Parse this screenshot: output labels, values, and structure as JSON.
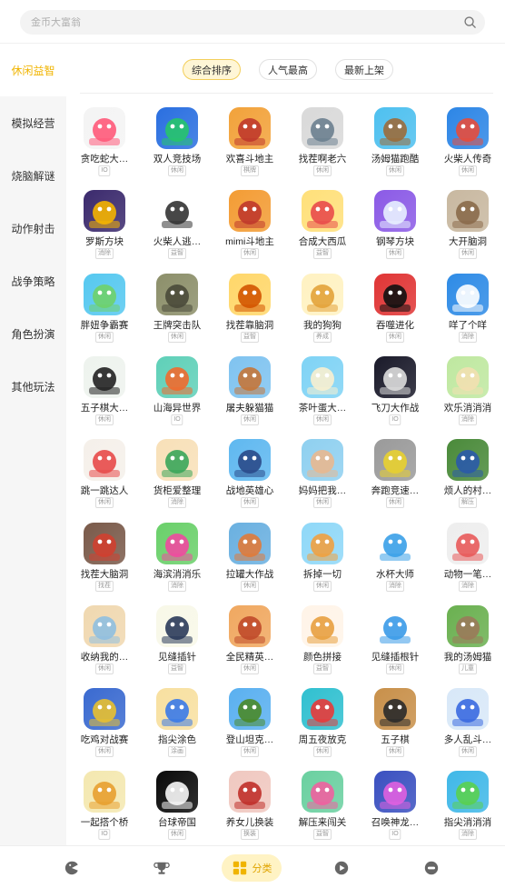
{
  "search": {
    "placeholder": "金币大富翁"
  },
  "sidebar": {
    "items": [
      {
        "label": "休闲益智",
        "active": true
      },
      {
        "label": "模拟经营"
      },
      {
        "label": "烧脑解谜"
      },
      {
        "label": "动作射击"
      },
      {
        "label": "战争策略"
      },
      {
        "label": "角色扮演"
      },
      {
        "label": "其他玩法"
      }
    ]
  },
  "sort": {
    "options": [
      {
        "label": "综合排序",
        "active": true
      },
      {
        "label": "人气最高"
      },
      {
        "label": "最新上架"
      }
    ]
  },
  "colors": {
    "accent": "#f0b400",
    "accent_bg": "#fff3c4",
    "sidebar_bg": "#f6f6f6"
  },
  "games": [
    {
      "name": "贪吃蛇大…",
      "tag": "IO",
      "c1": "#f4f4f4",
      "c2": "#ff5a7a"
    },
    {
      "name": "双人竞技场",
      "tag": "休闲",
      "c1": "#2a6fe0",
      "c2": "#27c46b"
    },
    {
      "name": "欢喜斗地主",
      "tag": "棋牌",
      "c1": "#f2a23a",
      "c2": "#c0392b"
    },
    {
      "name": "找茬啊老六",
      "tag": "休闲",
      "c1": "#d9d9d9",
      "c2": "#6b7f8f"
    },
    {
      "name": "汤姆猫跑酷",
      "tag": "休闲",
      "c1": "#4ec0ef",
      "c2": "#9b6b3b"
    },
    {
      "name": "火柴人传奇",
      "tag": "休闲",
      "c1": "#2d86e6",
      "c2": "#e74c3c"
    },
    {
      "name": "罗斯方块",
      "tag": "消除",
      "c1": "#3b2a6d",
      "c2": "#f5b400"
    },
    {
      "name": "火柴人逃…",
      "tag": "益智",
      "c1": "#ffffff",
      "c2": "#333333"
    },
    {
      "name": "mimi斗地主",
      "tag": "休闲",
      "c1": "#f39c34",
      "c2": "#c0392b"
    },
    {
      "name": "合成大西瓜",
      "tag": "益智",
      "c1": "#ffe07a",
      "c2": "#e94b4b"
    },
    {
      "name": "钢琴方块",
      "tag": "休闲",
      "c1": "#8b5ae6",
      "c2": "#e8f1ff"
    },
    {
      "name": "大开脑洞",
      "tag": "休闲",
      "c1": "#c8b8a0",
      "c2": "#8a6a4a"
    },
    {
      "name": "胖妞争霸赛",
      "tag": "休闲",
      "c1": "#56c8f0",
      "c2": "#6fd16a"
    },
    {
      "name": "王牌突击队",
      "tag": "休闲",
      "c1": "#8c8f6a",
      "c2": "#4a4a3a"
    },
    {
      "name": "找茬靠脑洞",
      "tag": "益智",
      "c1": "#ffd76a",
      "c2": "#d35400"
    },
    {
      "name": "我的狗狗",
      "tag": "养成",
      "c1": "#fff2c2",
      "c2": "#e3a33a"
    },
    {
      "name": "吞噬进化",
      "tag": "休闲",
      "c1": "#e03535",
      "c2": "#111111"
    },
    {
      "name": "咩了个咩",
      "tag": "消除",
      "c1": "#2e8be6",
      "c2": "#ffffff"
    },
    {
      "name": "五子棋大…",
      "tag": "休闲",
      "c1": "#eef3ee",
      "c2": "#222222"
    },
    {
      "name": "山海异世界",
      "tag": "IO",
      "c1": "#5fd0b8",
      "c2": "#f06a2e"
    },
    {
      "name": "屠夫躲猫猫",
      "tag": "休闲",
      "c1": "#7fc3f0",
      "c2": "#c4763a"
    },
    {
      "name": "茶叶蛋大…",
      "tag": "休闲",
      "c1": "#7fd3f5",
      "c2": "#f8f0d0"
    },
    {
      "name": "飞刀大作战",
      "tag": "IO",
      "c1": "#1a1a2a",
      "c2": "#dddddd"
    },
    {
      "name": "欢乐消消消",
      "tag": "消除",
      "c1": "#bfe8a0",
      "c2": "#f2e0b0"
    },
    {
      "name": "跳一跳达人",
      "tag": "休闲",
      "c1": "#f5f0ea",
      "c2": "#e84a4a"
    },
    {
      "name": "货柜爱整理",
      "tag": "消除",
      "c1": "#f8e0b8",
      "c2": "#3aa65a"
    },
    {
      "name": "战地英雄心",
      "tag": "休闲",
      "c1": "#5fb8f0",
      "c2": "#2a4a8a"
    },
    {
      "name": "妈妈把我…",
      "tag": "休闲",
      "c1": "#8fd0f0",
      "c2": "#e8b890"
    },
    {
      "name": "奔跑竞速…",
      "tag": "休闲",
      "c1": "#9a9a9a",
      "c2": "#e8d030"
    },
    {
      "name": "烦人的村…",
      "tag": "解压",
      "c1": "#4a8a3a",
      "c2": "#2a5aaa"
    },
    {
      "name": "找茬大脑洞",
      "tag": "找茬",
      "c1": "#7a5a4a",
      "c2": "#d04030"
    },
    {
      "name": "海滨消消乐",
      "tag": "消除",
      "c1": "#6ad06a",
      "c2": "#f04aa0"
    },
    {
      "name": "拉罐大作战",
      "tag": "休闲",
      "c1": "#6ab0e0",
      "c2": "#e07a3a"
    },
    {
      "name": "拆掉一切",
      "tag": "休闲",
      "c1": "#8fd8f8",
      "c2": "#f0a040"
    },
    {
      "name": "水杯大师",
      "tag": "消除",
      "c1": "#ffffff",
      "c2": "#3aa0e8"
    },
    {
      "name": "动物一笔…",
      "tag": "消除",
      "c1": "#eeeeee",
      "c2": "#e85a5a"
    },
    {
      "name": "收纳我的…",
      "tag": "休闲",
      "c1": "#f0d8b0",
      "c2": "#8fbfe0"
    },
    {
      "name": "见缝插针",
      "tag": "益智",
      "c1": "#f8f8e8",
      "c2": "#2a3a5a"
    },
    {
      "name": "全民精英…",
      "tag": "休闲",
      "c1": "#f0a860",
      "c2": "#c04a2a"
    },
    {
      "name": "颜色拼接",
      "tag": "益智",
      "c1": "#fff4e8",
      "c2": "#e8a040"
    },
    {
      "name": "见缝插根针",
      "tag": "休闲",
      "c1": "#ffffff",
      "c2": "#3a9ae8"
    },
    {
      "name": "我的汤姆猫",
      "tag": "儿童",
      "c1": "#6ab050",
      "c2": "#9a7a5a"
    },
    {
      "name": "吃鸡对战赛",
      "tag": "休闲",
      "c1": "#3a6ad0",
      "c2": "#e8c030"
    },
    {
      "name": "指尖涂色",
      "tag": "涂画",
      "c1": "#f8e0a0",
      "c2": "#3a7ae8"
    },
    {
      "name": "登山坦克…",
      "tag": "休闲",
      "c1": "#5ab0f0",
      "c2": "#4a8a2a"
    },
    {
      "name": "周五夜放克",
      "tag": "休闲",
      "c1": "#30c0d0",
      "c2": "#e83a3a"
    },
    {
      "name": "五子棋",
      "tag": "休闲",
      "c1": "#c8904a",
      "c2": "#2a2a2a"
    },
    {
      "name": "多人乱斗…",
      "tag": "休闲",
      "c1": "#d8e8f8",
      "c2": "#3a6ae0"
    },
    {
      "name": "一起搭个桥",
      "tag": "IO",
      "c1": "#f4e8b0",
      "c2": "#e8a030"
    },
    {
      "name": "台球帝国",
      "tag": "休闲",
      "c1": "#0a0a0a",
      "c2": "#f8f8f8"
    },
    {
      "name": "养女儿换装",
      "tag": "换装",
      "c1": "#f0c8c0",
      "c2": "#c0302a"
    },
    {
      "name": "解压来闯关",
      "tag": "益智",
      "c1": "#6ad0a0",
      "c2": "#f060a0"
    },
    {
      "name": "召唤神龙…",
      "tag": "IO",
      "c1": "#3a50c0",
      "c2": "#e060e0"
    },
    {
      "name": "指尖消消消",
      "tag": "消除",
      "c1": "#40b8e8",
      "c2": "#5ad050"
    }
  ],
  "bottom_nav": {
    "items": [
      {
        "icon": "pacman-icon"
      },
      {
        "icon": "trophy-icon"
      },
      {
        "icon": "category-icon",
        "label": "分类",
        "active": true
      },
      {
        "icon": "play-icon"
      },
      {
        "icon": "profile-icon"
      }
    ]
  }
}
